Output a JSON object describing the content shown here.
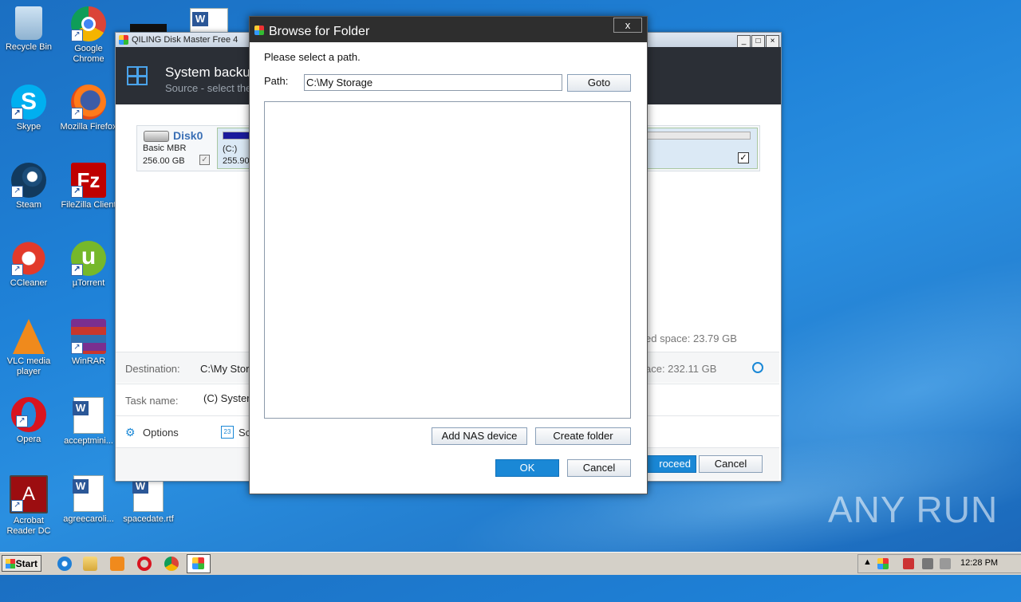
{
  "desktop": {
    "icons": [
      {
        "label": "Recycle Bin"
      },
      {
        "label": "Google Chrome"
      },
      {
        "label": "Skype"
      },
      {
        "label": "Mozilla Firefox"
      },
      {
        "label": "Steam"
      },
      {
        "label": "FileZilla Client"
      },
      {
        "label": "CCleaner"
      },
      {
        "label": "µTorrent"
      },
      {
        "label": "VLC media player"
      },
      {
        "label": "WinRAR"
      },
      {
        "label": "Opera"
      },
      {
        "label": "acceptmini..."
      },
      {
        "label": "Acrobat Reader DC"
      },
      {
        "label": "agreecaroli..."
      },
      {
        "label": "spacedate.rtf"
      }
    ],
    "watermark": "ANY RUN"
  },
  "back_window": {
    "title": "QILING Disk Master Free 4",
    "header_title": "System backu",
    "header_subtitle": "Source - select the",
    "disk": {
      "name": "Disk0",
      "type": "Basic MBR",
      "size": "256.00 GB",
      "partition_label": "(C:)",
      "partition_size": "255.90"
    },
    "used_space": "ed space: 23.79 GB",
    "destination_label": "Destination:",
    "destination_value": "C:\\My Stor",
    "free_space": "ace: 232.11 GB",
    "task_name_label": "Task name:",
    "task_name_value": "(C) Syster",
    "options_label": "Options",
    "schedule_label": "Sc",
    "proceed_label": "roceed",
    "cancel_label": "Cancel"
  },
  "dialog": {
    "title": "Browse for Folder",
    "close_label": "x",
    "prompt": "Please select a path.",
    "path_label": "Path:",
    "path_value": "C:\\My Storage",
    "goto_label": "Goto",
    "add_nas_label": "Add NAS device",
    "create_folder_label": "Create folder",
    "ok_label": "OK",
    "cancel_label": "Cancel"
  },
  "taskbar": {
    "start_label": "Start",
    "clock": "12:28 PM"
  },
  "colors": {
    "desktop_bg": "#1f82d8",
    "dark_header": "#2b2f36",
    "dialog_title": "#2e2e2e",
    "primary_button": "#1a88d6"
  }
}
